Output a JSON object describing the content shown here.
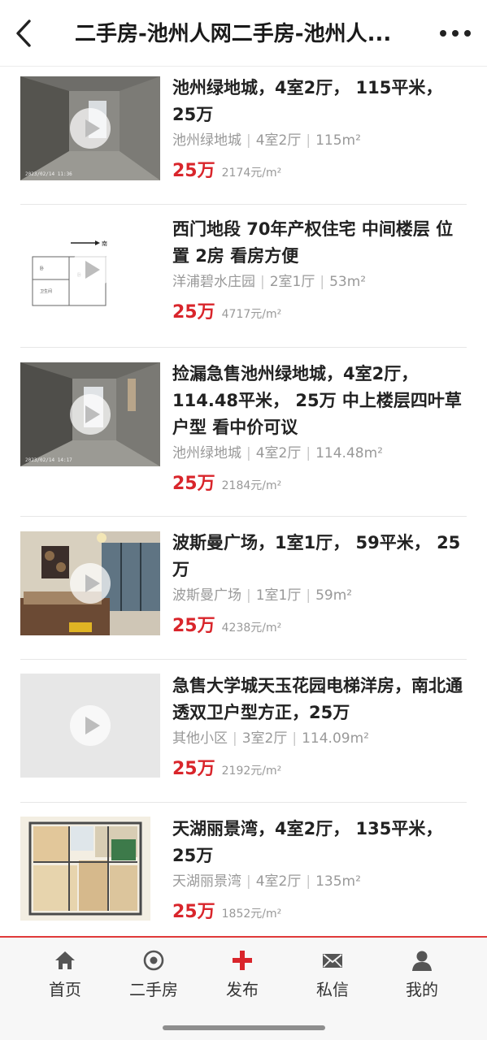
{
  "header": {
    "title": "二手房-池州人网二手房-池州人...",
    "back_icon": "back-icon",
    "more_icon": "more-icon"
  },
  "listings": [
    {
      "title": "池州绿地城，4室2厅， 115平米， 25万",
      "community": "池州绿地城",
      "layout": "4室2厅",
      "area": "115m²",
      "price": "25万",
      "unit_price": "2174元/m²",
      "stamp": "2023/02/14 11:36",
      "thumb": "empty-room"
    },
    {
      "title": "西门地段 70年产权住宅 中间楼层 位置 2房 看房方便",
      "community": "洋浦碧水庄园",
      "layout": "2室1厅",
      "area": "53m²",
      "price": "25万",
      "unit_price": "4717元/m²",
      "thumb": "floor-sketch"
    },
    {
      "title": "捡漏急售池州绿地城，4室2厅， 114.48平米， 25万 中上楼层四叶草户型 看中价可议",
      "community": "池州绿地城",
      "layout": "4室2厅",
      "area": "114.48m²",
      "price": "25万",
      "unit_price": "2184元/m²",
      "stamp": "2023/02/14 14:17",
      "thumb": "empty-room"
    },
    {
      "title": "波斯曼广场，1室1厅， 59平米， 25万",
      "community": "波斯曼广场",
      "layout": "1室1厅",
      "area": "59m²",
      "price": "25万",
      "unit_price": "4238元/m²",
      "thumb": "bedroom"
    },
    {
      "title": "急售大学城天玉花园电梯洋房，南北通透双卫户型方正，25万",
      "community": "其他小区",
      "layout": "3室2厅",
      "area": "114.09m²",
      "price": "25万",
      "unit_price": "2192元/m²",
      "thumb": "placeholder"
    },
    {
      "title": "天湖丽景湾，4室2厅， 135平米， 25万",
      "community": "天湖丽景湾",
      "layout": "4室2厅",
      "area": "135m²",
      "price": "25万",
      "unit_price": "1852元/m²",
      "thumb": "floor-plan"
    }
  ],
  "tabbar": {
    "items": [
      {
        "label": "首页",
        "icon": "home-icon"
      },
      {
        "label": "二手房",
        "icon": "target-icon"
      },
      {
        "label": "发布",
        "icon": "plus-icon"
      },
      {
        "label": "私信",
        "icon": "mail-icon"
      },
      {
        "label": "我的",
        "icon": "user-icon"
      }
    ]
  },
  "colors": {
    "accent": "#d9252b",
    "meta": "#999999",
    "divider": "#e6e6e6"
  }
}
